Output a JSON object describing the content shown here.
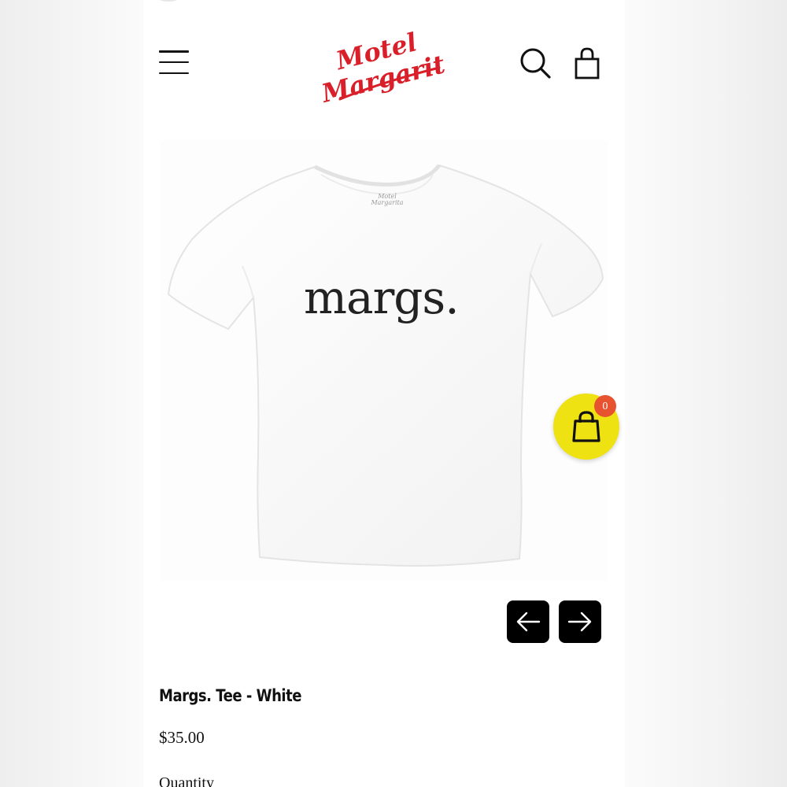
{
  "header": {
    "logo_line1": "Motel",
    "logo_line2": "Margarita",
    "menu_icon": "hamburger-icon",
    "search_icon": "search-icon",
    "bag_icon": "shopping-bag-icon"
  },
  "product": {
    "shirt_print": "margs.",
    "collar_tag_line1": "Motel",
    "collar_tag_line2": "Margarita",
    "title": "Margs. Tee - White",
    "price": "$35.00",
    "quantity_label": "Quantity"
  },
  "cart": {
    "count": "0",
    "icon": "shopping-bag-icon"
  },
  "gallery": {
    "prev_icon": "arrow-left-icon",
    "next_icon": "arrow-right-icon"
  },
  "colors": {
    "brand_red": "#d9202a",
    "cart_yellow": "#efe213",
    "badge_orange": "#e6532e"
  }
}
